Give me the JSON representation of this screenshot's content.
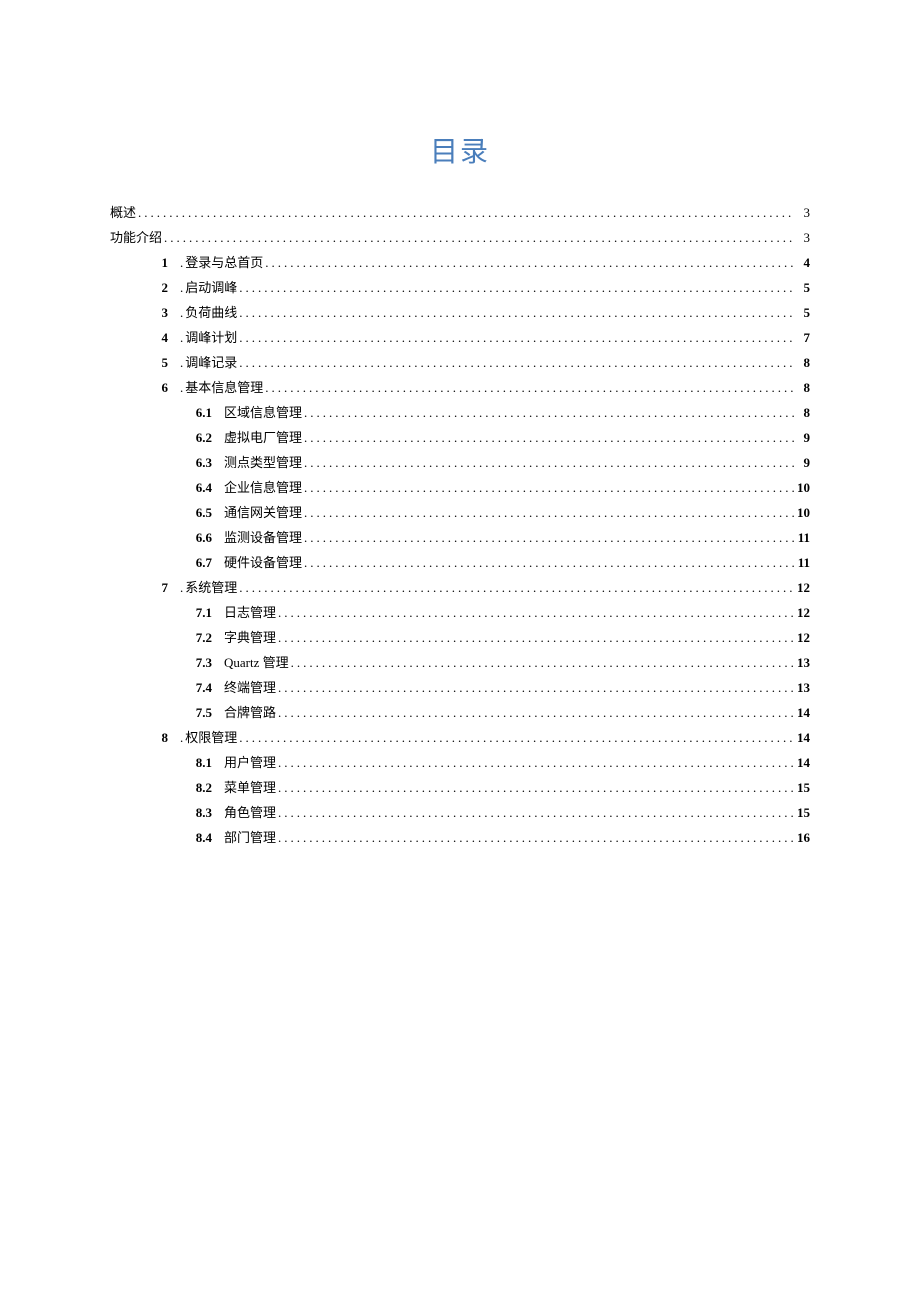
{
  "title": "目录",
  "dots": "....................................................................................................................................................................................................................",
  "entries": [
    {
      "level": 0,
      "num": "",
      "prefix": "",
      "label": "概述",
      "page": "3"
    },
    {
      "level": 0,
      "num": "",
      "prefix": "",
      "label": "功能介绍",
      "page": "3"
    },
    {
      "level": 1,
      "num": "1",
      "prefix": ".",
      "label": "登录与总首页",
      "page": "4"
    },
    {
      "level": 1,
      "num": "2",
      "prefix": ".",
      "label": "启动调峰",
      "page": "5"
    },
    {
      "level": 1,
      "num": "3",
      "prefix": ". ",
      "label": "负荷曲线",
      "page": "5"
    },
    {
      "level": 1,
      "num": "4",
      "prefix": ".",
      "label": "调峰计划",
      "page": "7"
    },
    {
      "level": 1,
      "num": "5",
      "prefix": ". ",
      "label": "调峰记录",
      "page": "8"
    },
    {
      "level": 1,
      "num": "6",
      "prefix": ".",
      "label": "基本信息管理",
      "page": "8"
    },
    {
      "level": 2,
      "num": "6.1",
      "prefix": "",
      "label": "区域信息管理",
      "page": "8"
    },
    {
      "level": 2,
      "num": "6.2",
      "prefix": "",
      "label": "虚拟电厂管理",
      "page": "9"
    },
    {
      "level": 2,
      "num": "6.3",
      "prefix": "",
      "label": "测点类型管理",
      "page": "9"
    },
    {
      "level": 2,
      "num": "6.4",
      "prefix": "",
      "label": "企业信息管理",
      "page": "10"
    },
    {
      "level": 2,
      "num": "6.5",
      "prefix": "",
      "label": "通信网关管理",
      "page": "10"
    },
    {
      "level": 2,
      "num": "6.6",
      "prefix": "",
      "label": "监测设备管理",
      "page": "11"
    },
    {
      "level": 2,
      "num": "6.7",
      "prefix": "",
      "label": "硬件设备管理",
      "page": "11"
    },
    {
      "level": 1,
      "num": "7",
      "prefix": ".",
      "label": "系统管理",
      "page": "12"
    },
    {
      "level": 2,
      "num": "7.1",
      "prefix": "",
      "label": "日志管理",
      "page": "12"
    },
    {
      "level": 2,
      "num": "7.2",
      "prefix": "",
      "label": "字典管理",
      "page": "12"
    },
    {
      "level": 2,
      "num": "7.3",
      "prefix": "",
      "label": "Quartz 管理",
      "page": "13"
    },
    {
      "level": 2,
      "num": "7.4",
      "prefix": "",
      "label": "终端管理",
      "page": "13"
    },
    {
      "level": 2,
      "num": "7.5",
      "prefix": "",
      "label": "合牌管路",
      "page": "14"
    },
    {
      "level": 1,
      "num": "8",
      "prefix": ". ",
      "label": "权限管理",
      "page": "14"
    },
    {
      "level": 2,
      "num": "8.1",
      "prefix": "",
      "label": "用户管理",
      "page": "14"
    },
    {
      "level": 2,
      "num": "8.2",
      "prefix": "",
      "label": "菜单管理",
      "page": "15"
    },
    {
      "level": 2,
      "num": "8.3",
      "prefix": "",
      "label": "角色管理",
      "page": "15"
    },
    {
      "level": 2,
      "num": "8.4",
      "prefix": "",
      "label": "部门管理",
      "page": "16"
    }
  ]
}
